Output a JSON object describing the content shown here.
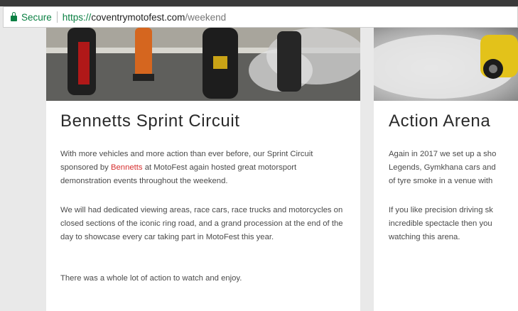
{
  "browser": {
    "secure_label": "Secure",
    "url_scheme": "https://",
    "url_host": "coventrymotofest.com",
    "url_path": "/weekend"
  },
  "cards": [
    {
      "title": "Bennetts Sprint Circuit",
      "p1_before": "With more vehicles and more action than ever before, our Sprint Circuit sponsored by ",
      "p1_link": "Bennetts",
      "p1_after": " at MotoFest again hosted great motorsport demonstration events throughout the weekend.",
      "p2": "We will had dedicated viewing areas, race cars, race trucks and motorcycles on closed sections of the iconic ring road, and a grand procession at the end of the day to showcase every car taking part in MotoFest this year.",
      "p3": "There was a whole lot of action to watch and enjoy."
    },
    {
      "title": "Action Arena",
      "p1_lines": [
        "Again in 2017 we set up a sho",
        "Legends, Gymkhana cars and",
        "of tyre smoke in a venue with"
      ],
      "p2_lines": [
        "If you like precision driving sk",
        "incredible spectacle then you",
        "watching this arena."
      ]
    }
  ],
  "colors": {
    "link": "#d62f2f",
    "secure": "#0b8043"
  }
}
